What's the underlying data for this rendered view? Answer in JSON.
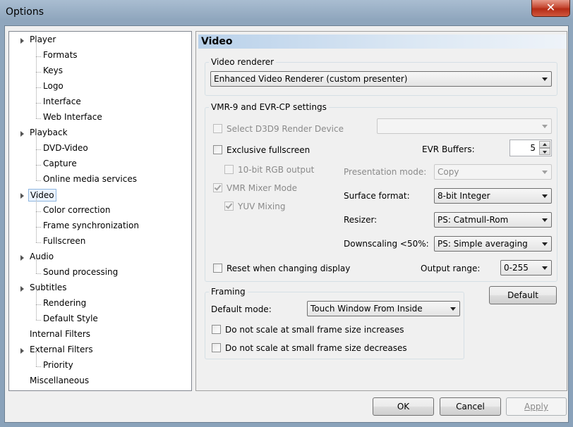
{
  "window": {
    "title": "Options",
    "close_glyph": "✕"
  },
  "tree": [
    {
      "label": "Player",
      "level": 0,
      "expanded": true
    },
    {
      "label": "Formats",
      "level": 1,
      "selected_hint": true
    },
    {
      "label": "Keys",
      "level": 1
    },
    {
      "label": "Logo",
      "level": 1
    },
    {
      "label": "Interface",
      "level": 1
    },
    {
      "label": "Web Interface",
      "level": 1
    },
    {
      "label": "Playback",
      "level": 0,
      "expanded": true
    },
    {
      "label": "DVD-Video",
      "level": 1
    },
    {
      "label": "Capture",
      "level": 1
    },
    {
      "label": "Online media services",
      "level": 1
    },
    {
      "label": "Video",
      "level": 0,
      "expanded": true,
      "selected": true
    },
    {
      "label": "Color correction",
      "level": 1
    },
    {
      "label": "Frame synchronization",
      "level": 1
    },
    {
      "label": "Fullscreen",
      "level": 1
    },
    {
      "label": "Audio",
      "level": 0,
      "expanded": true
    },
    {
      "label": "Sound processing",
      "level": 1
    },
    {
      "label": "Subtitles",
      "level": 0,
      "expanded": true
    },
    {
      "label": "Rendering",
      "level": 1
    },
    {
      "label": "Default Style",
      "level": 1
    },
    {
      "label": "Internal Filters",
      "level": 0
    },
    {
      "label": "External Filters",
      "level": 0,
      "expanded": true
    },
    {
      "label": "Priority",
      "level": 1
    },
    {
      "label": "Miscellaneous",
      "level": 0
    }
  ],
  "panel": {
    "header": "Video",
    "video_renderer": {
      "group_label": "Video renderer",
      "value": "Enhanced Video Renderer (custom presenter)"
    },
    "vmr": {
      "group_label": "VMR-9 and EVR-CP settings",
      "select_d3d9": "Select D3D9 Render Device",
      "exclusive_fullscreen": "Exclusive fullscreen",
      "rgb_10bit": "10-bit RGB output",
      "vmr_mixer": "VMR Mixer Mode",
      "yuv_mixing": "YUV Mixing",
      "reset_display": "Reset when changing display",
      "evr_buffers_label": "EVR Buffers:",
      "evr_buffers_value": "5",
      "presentation_mode_label": "Presentation mode:",
      "presentation_mode_value": "Copy",
      "surface_format_label": "Surface format:",
      "surface_format_value": "8-bit Integer",
      "resizer_label": "Resizer:",
      "resizer_value": "PS: Catmull-Rom",
      "downscaling_label": "Downscaling <50%:",
      "downscaling_value": "PS: Simple averaging",
      "output_range_label": "Output range:",
      "output_range_value": "0-255"
    },
    "framing": {
      "group_label": "Framing",
      "default_mode_label": "Default mode:",
      "default_mode_value": "Touch Window From Inside",
      "no_scale_increase": "Do not scale at small frame size increases",
      "no_scale_decrease": "Do not scale at small frame size decreases"
    },
    "default_button": "Default"
  },
  "footer": {
    "ok": "OK",
    "cancel": "Cancel",
    "apply": "Apply"
  }
}
